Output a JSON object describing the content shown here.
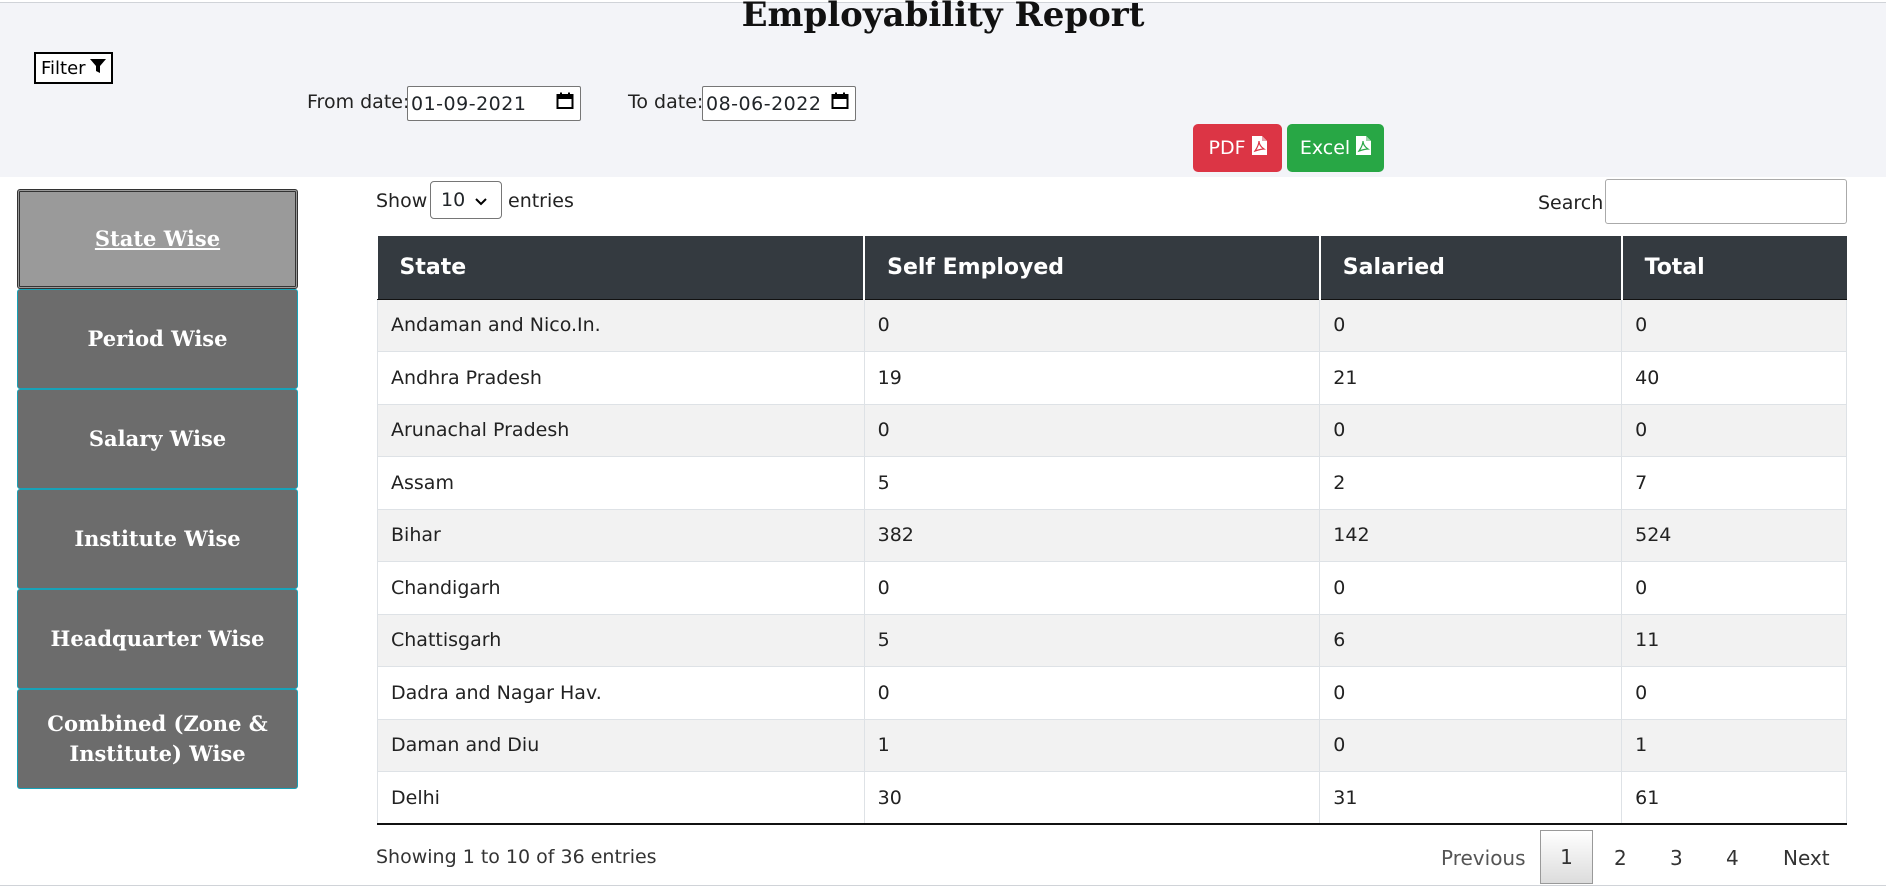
{
  "header": {
    "title": "Employability Report",
    "filter_label": "Filter",
    "from_label": "From date:",
    "from_value": "01-09-2021",
    "to_label": "To date:",
    "to_value": "08-06-2022",
    "pdf_label": "PDF",
    "excel_label": "Excel"
  },
  "sidebar": {
    "items": [
      {
        "label": "State Wise"
      },
      {
        "label": "Period Wise"
      },
      {
        "label": "Salary Wise"
      },
      {
        "label": "Institute Wise"
      },
      {
        "label": "Headquarter Wise"
      },
      {
        "label": "Combined (Zone & Institute) Wise"
      }
    ]
  },
  "controls": {
    "show_label": "Show",
    "entries_value": "10",
    "entries_label": "entries",
    "search_label": "Search:"
  },
  "table": {
    "columns": [
      "State",
      "Self Employed",
      "Salaried",
      "Total"
    ],
    "rows": [
      [
        "Andaman and Nico.In.",
        "0",
        "0",
        "0"
      ],
      [
        "Andhra Pradesh",
        "19",
        "21",
        "40"
      ],
      [
        "Arunachal Pradesh",
        "0",
        "0",
        "0"
      ],
      [
        "Assam",
        "5",
        "2",
        "7"
      ],
      [
        "Bihar",
        "382",
        "142",
        "524"
      ],
      [
        "Chandigarh",
        "0",
        "0",
        "0"
      ],
      [
        "Chattisgarh",
        "5",
        "6",
        "11"
      ],
      [
        "Dadra and Nagar Hav.",
        "0",
        "0",
        "0"
      ],
      [
        "Daman and Diu",
        "1",
        "0",
        "1"
      ],
      [
        "Delhi",
        "30",
        "31",
        "61"
      ]
    ]
  },
  "footer": {
    "info": "Showing 1 to 10 of 36 entries",
    "previous": "Previous",
    "pages": [
      "1",
      "2",
      "3",
      "4"
    ],
    "next": "Next"
  },
  "colors": {
    "pdf": "#dc3545",
    "excel": "#28a745",
    "table_header": "#343a40",
    "sidebar": "#6c6c6c"
  }
}
